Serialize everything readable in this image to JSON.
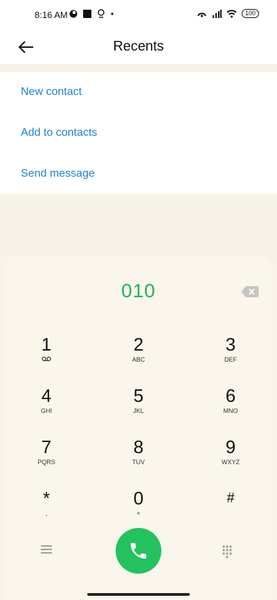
{
  "status": {
    "time": "8:16 AM",
    "battery": "100"
  },
  "header": {
    "title": "Recents",
    "back_icon": "arrow-left-icon"
  },
  "actions": [
    {
      "label": "New contact"
    },
    {
      "label": "Add to contacts"
    },
    {
      "label": "Send message"
    }
  ],
  "dialer": {
    "number": "010",
    "keys": [
      {
        "digit": "1",
        "letters": "oo"
      },
      {
        "digit": "2",
        "letters": "ABC"
      },
      {
        "digit": "3",
        "letters": "DEF"
      },
      {
        "digit": "4",
        "letters": "GHI"
      },
      {
        "digit": "5",
        "letters": "JKL"
      },
      {
        "digit": "6",
        "letters": "MNO"
      },
      {
        "digit": "7",
        "letters": "PQRS"
      },
      {
        "digit": "8",
        "letters": "TUV"
      },
      {
        "digit": "9",
        "letters": "WXYZ"
      },
      {
        "digit": "*",
        "letters": ","
      },
      {
        "digit": "0",
        "letters": "+"
      },
      {
        "digit": "#",
        "letters": ""
      }
    ]
  },
  "colors": {
    "accent_blue": "#1a7fd4",
    "call_green": "#24c15f",
    "number_green": "#27b15b"
  }
}
